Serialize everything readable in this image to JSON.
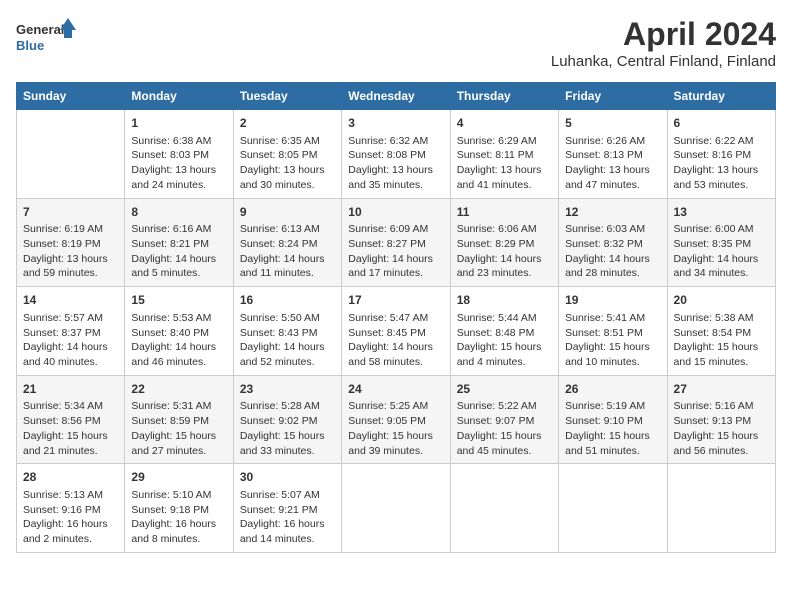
{
  "header": {
    "logo_general": "General",
    "logo_blue": "Blue",
    "month_year": "April 2024",
    "location": "Luhanka, Central Finland, Finland"
  },
  "weekdays": [
    "Sunday",
    "Monday",
    "Tuesday",
    "Wednesday",
    "Thursday",
    "Friday",
    "Saturday"
  ],
  "weeks": [
    [
      {
        "day": "",
        "sunrise": "",
        "sunset": "",
        "daylight": ""
      },
      {
        "day": "1",
        "sunrise": "Sunrise: 6:38 AM",
        "sunset": "Sunset: 8:03 PM",
        "daylight": "Daylight: 13 hours and 24 minutes."
      },
      {
        "day": "2",
        "sunrise": "Sunrise: 6:35 AM",
        "sunset": "Sunset: 8:05 PM",
        "daylight": "Daylight: 13 hours and 30 minutes."
      },
      {
        "day": "3",
        "sunrise": "Sunrise: 6:32 AM",
        "sunset": "Sunset: 8:08 PM",
        "daylight": "Daylight: 13 hours and 35 minutes."
      },
      {
        "day": "4",
        "sunrise": "Sunrise: 6:29 AM",
        "sunset": "Sunset: 8:11 PM",
        "daylight": "Daylight: 13 hours and 41 minutes."
      },
      {
        "day": "5",
        "sunrise": "Sunrise: 6:26 AM",
        "sunset": "Sunset: 8:13 PM",
        "daylight": "Daylight: 13 hours and 47 minutes."
      },
      {
        "day": "6",
        "sunrise": "Sunrise: 6:22 AM",
        "sunset": "Sunset: 8:16 PM",
        "daylight": "Daylight: 13 hours and 53 minutes."
      }
    ],
    [
      {
        "day": "7",
        "sunrise": "Sunrise: 6:19 AM",
        "sunset": "Sunset: 8:19 PM",
        "daylight": "Daylight: 13 hours and 59 minutes."
      },
      {
        "day": "8",
        "sunrise": "Sunrise: 6:16 AM",
        "sunset": "Sunset: 8:21 PM",
        "daylight": "Daylight: 14 hours and 5 minutes."
      },
      {
        "day": "9",
        "sunrise": "Sunrise: 6:13 AM",
        "sunset": "Sunset: 8:24 PM",
        "daylight": "Daylight: 14 hours and 11 minutes."
      },
      {
        "day": "10",
        "sunrise": "Sunrise: 6:09 AM",
        "sunset": "Sunset: 8:27 PM",
        "daylight": "Daylight: 14 hours and 17 minutes."
      },
      {
        "day": "11",
        "sunrise": "Sunrise: 6:06 AM",
        "sunset": "Sunset: 8:29 PM",
        "daylight": "Daylight: 14 hours and 23 minutes."
      },
      {
        "day": "12",
        "sunrise": "Sunrise: 6:03 AM",
        "sunset": "Sunset: 8:32 PM",
        "daylight": "Daylight: 14 hours and 28 minutes."
      },
      {
        "day": "13",
        "sunrise": "Sunrise: 6:00 AM",
        "sunset": "Sunset: 8:35 PM",
        "daylight": "Daylight: 14 hours and 34 minutes."
      }
    ],
    [
      {
        "day": "14",
        "sunrise": "Sunrise: 5:57 AM",
        "sunset": "Sunset: 8:37 PM",
        "daylight": "Daylight: 14 hours and 40 minutes."
      },
      {
        "day": "15",
        "sunrise": "Sunrise: 5:53 AM",
        "sunset": "Sunset: 8:40 PM",
        "daylight": "Daylight: 14 hours and 46 minutes."
      },
      {
        "day": "16",
        "sunrise": "Sunrise: 5:50 AM",
        "sunset": "Sunset: 8:43 PM",
        "daylight": "Daylight: 14 hours and 52 minutes."
      },
      {
        "day": "17",
        "sunrise": "Sunrise: 5:47 AM",
        "sunset": "Sunset: 8:45 PM",
        "daylight": "Daylight: 14 hours and 58 minutes."
      },
      {
        "day": "18",
        "sunrise": "Sunrise: 5:44 AM",
        "sunset": "Sunset: 8:48 PM",
        "daylight": "Daylight: 15 hours and 4 minutes."
      },
      {
        "day": "19",
        "sunrise": "Sunrise: 5:41 AM",
        "sunset": "Sunset: 8:51 PM",
        "daylight": "Daylight: 15 hours and 10 minutes."
      },
      {
        "day": "20",
        "sunrise": "Sunrise: 5:38 AM",
        "sunset": "Sunset: 8:54 PM",
        "daylight": "Daylight: 15 hours and 15 minutes."
      }
    ],
    [
      {
        "day": "21",
        "sunrise": "Sunrise: 5:34 AM",
        "sunset": "Sunset: 8:56 PM",
        "daylight": "Daylight: 15 hours and 21 minutes."
      },
      {
        "day": "22",
        "sunrise": "Sunrise: 5:31 AM",
        "sunset": "Sunset: 8:59 PM",
        "daylight": "Daylight: 15 hours and 27 minutes."
      },
      {
        "day": "23",
        "sunrise": "Sunrise: 5:28 AM",
        "sunset": "Sunset: 9:02 PM",
        "daylight": "Daylight: 15 hours and 33 minutes."
      },
      {
        "day": "24",
        "sunrise": "Sunrise: 5:25 AM",
        "sunset": "Sunset: 9:05 PM",
        "daylight": "Daylight: 15 hours and 39 minutes."
      },
      {
        "day": "25",
        "sunrise": "Sunrise: 5:22 AM",
        "sunset": "Sunset: 9:07 PM",
        "daylight": "Daylight: 15 hours and 45 minutes."
      },
      {
        "day": "26",
        "sunrise": "Sunrise: 5:19 AM",
        "sunset": "Sunset: 9:10 PM",
        "daylight": "Daylight: 15 hours and 51 minutes."
      },
      {
        "day": "27",
        "sunrise": "Sunrise: 5:16 AM",
        "sunset": "Sunset: 9:13 PM",
        "daylight": "Daylight: 15 hours and 56 minutes."
      }
    ],
    [
      {
        "day": "28",
        "sunrise": "Sunrise: 5:13 AM",
        "sunset": "Sunset: 9:16 PM",
        "daylight": "Daylight: 16 hours and 2 minutes."
      },
      {
        "day": "29",
        "sunrise": "Sunrise: 5:10 AM",
        "sunset": "Sunset: 9:18 PM",
        "daylight": "Daylight: 16 hours and 8 minutes."
      },
      {
        "day": "30",
        "sunrise": "Sunrise: 5:07 AM",
        "sunset": "Sunset: 9:21 PM",
        "daylight": "Daylight: 16 hours and 14 minutes."
      },
      {
        "day": "",
        "sunrise": "",
        "sunset": "",
        "daylight": ""
      },
      {
        "day": "",
        "sunrise": "",
        "sunset": "",
        "daylight": ""
      },
      {
        "day": "",
        "sunrise": "",
        "sunset": "",
        "daylight": ""
      },
      {
        "day": "",
        "sunrise": "",
        "sunset": "",
        "daylight": ""
      }
    ]
  ]
}
